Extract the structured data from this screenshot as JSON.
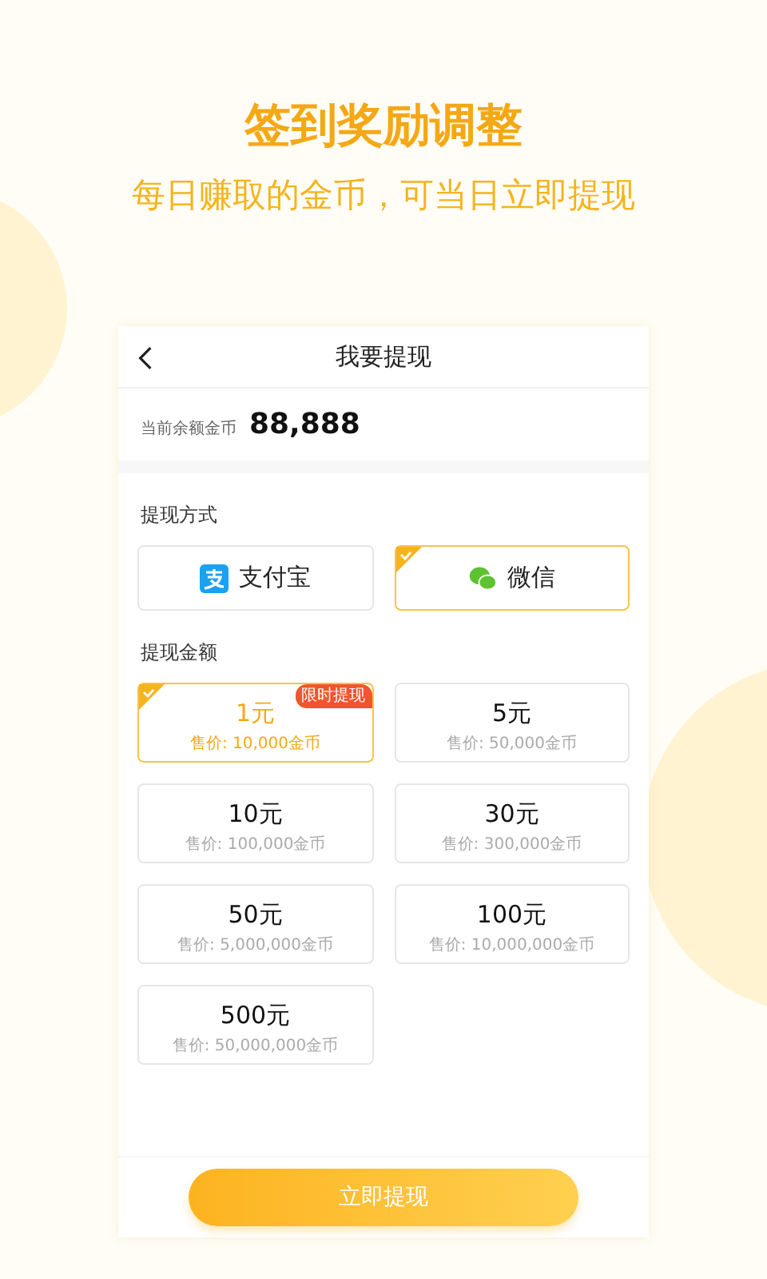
{
  "headline": "签到奖励调整",
  "subheadline": "每日赚取的金币，可当日立即提现",
  "screen": {
    "title": "我要提现",
    "balance_label": "当前余额金币",
    "balance": "88,888"
  },
  "method_label": "提现方式",
  "methods": [
    {
      "kind": "alipay",
      "label": "支付宝",
      "selected": false
    },
    {
      "kind": "wechat",
      "label": "微信",
      "selected": true
    }
  ],
  "amount_label": "提现金额",
  "amounts": [
    {
      "amount": "1元",
      "price": "售价: 10,000金币",
      "selected": true,
      "badge": "限时提现"
    },
    {
      "amount": "5元",
      "price": "售价: 50,000金币",
      "selected": false
    },
    {
      "amount": "10元",
      "price": "售价: 100,000金币",
      "selected": false
    },
    {
      "amount": "30元",
      "price": "售价: 300,000金币",
      "selected": false
    },
    {
      "amount": "50元",
      "price": "售价: 5,000,000金币",
      "selected": false
    },
    {
      "amount": "100元",
      "price": "售价: 10,000,000金币",
      "selected": false
    },
    {
      "amount": "500元",
      "price": "售价: 50,000,000金币",
      "selected": false
    }
  ],
  "submit": "立即提现"
}
